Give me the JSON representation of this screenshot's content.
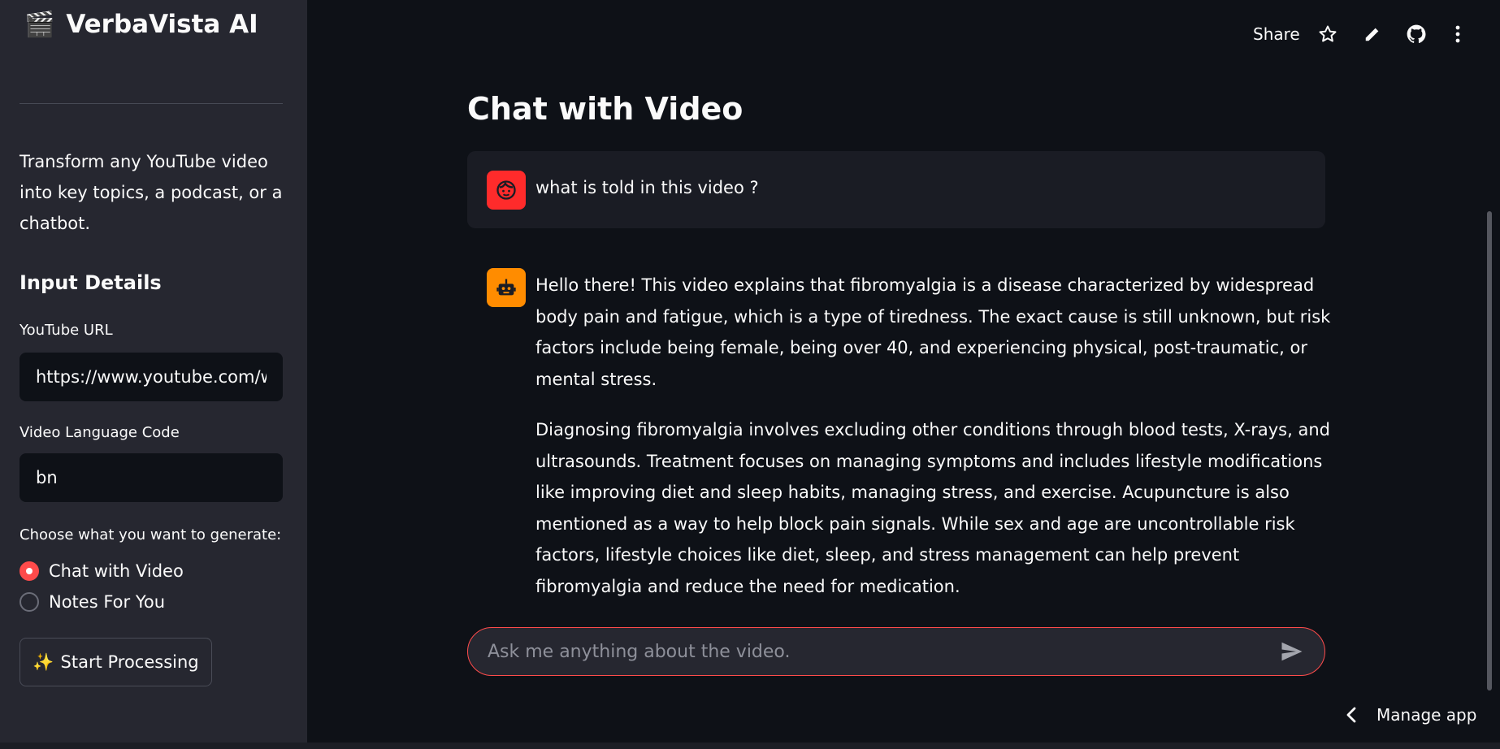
{
  "sidebar": {
    "brand_icon": "🎬",
    "brand_title": "VerbaVista AI",
    "description": "Transform any YouTube video into key topics, a podcast, or a chatbot.",
    "heading": "Input Details",
    "url_label": "YouTube URL",
    "url_value": "https://www.youtube.com/watch",
    "lang_label": "Video Language Code",
    "lang_value": "bn",
    "choose_label": "Choose what you want to generate:",
    "options": [
      {
        "label": "Chat with Video",
        "checked": true
      },
      {
        "label": "Notes For You",
        "checked": false
      }
    ],
    "start_icon": "✨",
    "start_label": "Start Processing"
  },
  "topbar": {
    "share_label": "Share",
    "icons": [
      "star-icon",
      "pencil-icon",
      "github-icon",
      "more-vertical-icon"
    ]
  },
  "main": {
    "title": "Chat with Video",
    "user_message": "what is told in this video ?",
    "bot_paragraphs": [
      "Hello there! This video explains that fibromyalgia is a disease characterized by widespread body pain and fatigue, which is a type of tiredness. The exact cause is still unknown, but risk factors include being female, being over 40, and experiencing physical, post-traumatic, or mental stress.",
      "Diagnosing fibromyalgia involves excluding other conditions through blood tests, X-rays, and ultrasounds. Treatment focuses on managing symptoms and includes lifestyle modifications like improving diet and sleep habits, managing stress, and exercise. Acupuncture is also mentioned as a way to help block pain signals. While sex and age are uncontrollable risk factors, lifestyle choices like diet, sleep, and stress management can help prevent fibromyalgia and reduce the need for medication."
    ],
    "input_placeholder": "Ask me anything about the video."
  },
  "footer": {
    "manage_label": "Manage app"
  },
  "colors": {
    "accent": "#ff4b4b",
    "user_avatar": "#ff2b2b",
    "bot_avatar": "#ff8c00",
    "sidebar_bg": "#262730",
    "main_bg": "#0e1117"
  }
}
